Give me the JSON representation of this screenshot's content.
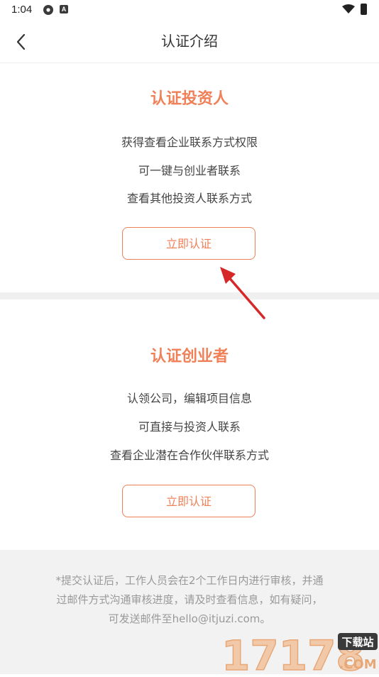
{
  "status_bar": {
    "time": "1:04",
    "gear_icon": "settings-icon",
    "app_icon_letter": "A",
    "wifi_icon": "wifi-icon",
    "battery_icon": "battery-icon"
  },
  "nav": {
    "back_icon": "chevron-left-icon",
    "title": "认证介绍"
  },
  "investor_card": {
    "title": "认证投资人",
    "benefits": [
      "获得查看企业联系方式权限",
      "可一键与创业者联系",
      "查看其他投资人联系方式"
    ],
    "button_label": "立即认证"
  },
  "founder_card": {
    "title": "认证创业者",
    "benefits": [
      "认领公司，编辑项目信息",
      "可直接与投资人联系",
      "查看企业潜在合作伙伴联系方式"
    ],
    "button_label": "立即认证"
  },
  "footer": {
    "note_line1": "*提交认证后，工作人员会在2个工作日内进行审核，并通",
    "note_line2": "过邮件方式沟通审核进度，请及时查看信息，如有疑问，",
    "note_line3": "可发送邮件至hello@itjuzi.com。"
  },
  "watermark": {
    "number": "17178",
    "tag": "下载站",
    "domain": ".COM"
  },
  "colors": {
    "accent": "#f08058",
    "annotation_arrow": "#d62828",
    "divider": "#f0f0f0",
    "footer_bg": "#f2f2f2"
  }
}
